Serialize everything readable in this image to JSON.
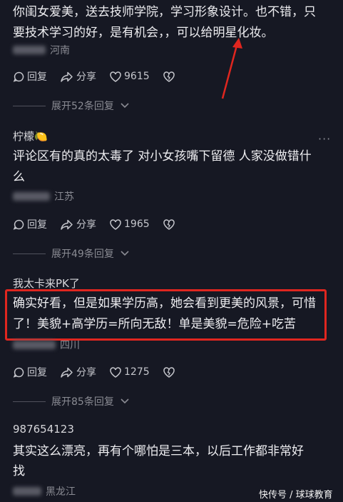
{
  "comments": [
    {
      "username": "",
      "lines": [
        "你闺女爱美，送去技师学院，学习形象设计。也不错，只",
        "要技术学习的好，是有机会，，可以给明星化妆。"
      ],
      "location": "河南",
      "reply_label": "回复",
      "share_label": "分享",
      "likes": "9615",
      "expand_label": "展开52条回复"
    },
    {
      "username": "柠檬🍋",
      "lines": [
        "评论区有的真的太毒了 对小女孩嘴下留德 人家没做错什",
        "么"
      ],
      "location": "江苏",
      "reply_label": "回复",
      "share_label": "分享",
      "likes": "1965",
      "expand_label": "展开49条回复"
    },
    {
      "username": "我太卡来PK了",
      "lines": [
        "确实好看，但是如果学历高，她会看到更美的风景，可惜",
        "了！美貌+高学历=所向无敌！单是美貌=危险+吃苦"
      ],
      "location": "四川",
      "reply_label": "回复",
      "share_label": "分享",
      "likes": "1275",
      "expand_label": "展开85条回复"
    },
    {
      "username": "987654123",
      "lines": [
        "其实这么漂亮，再有个哪怕是三本，以后工作都非常好",
        "找"
      ],
      "location": "黑龙江"
    }
  ],
  "more_icon": "···",
  "watermark": "快传号 / 球球教育",
  "colors": {
    "background": "#161823",
    "highlight": "#e0261f",
    "arrow": "#e0261f"
  }
}
